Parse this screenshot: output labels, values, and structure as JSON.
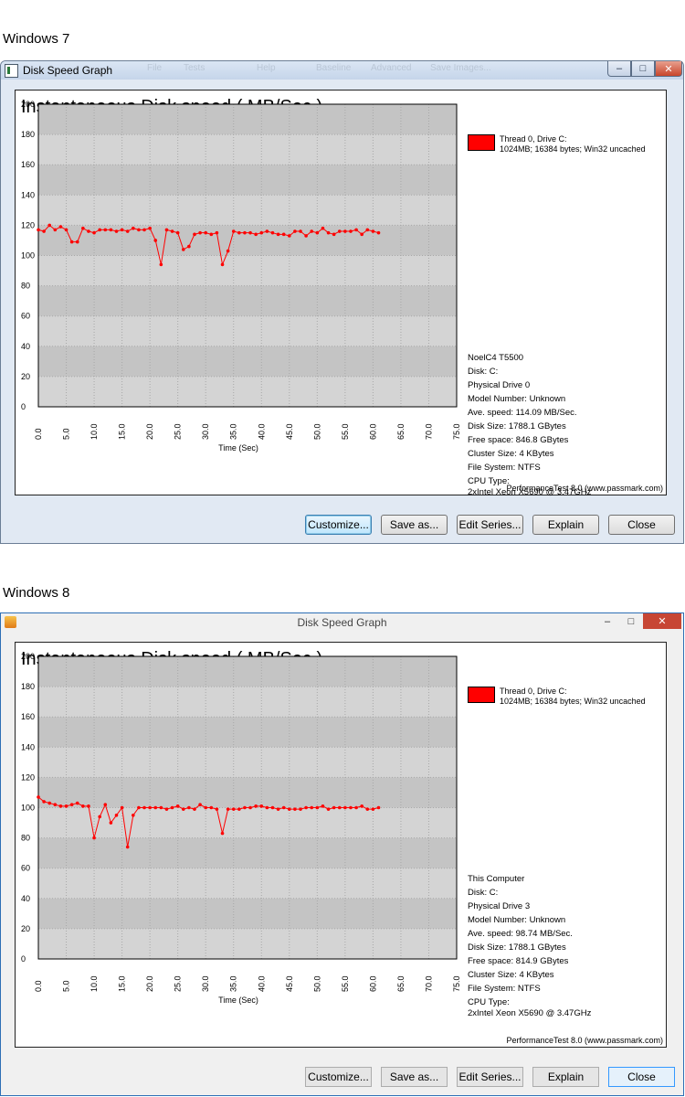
{
  "captions": {
    "win7": "Windows 7",
    "win8": "Windows 8"
  },
  "shared": {
    "window_title": "Disk Speed Graph",
    "graph_title": "Instantaneous Disk speed ( MB/Sec.)",
    "legend_line1": "Thread 0, Drive C:",
    "legend_line2": "1024MB; 16384 bytes; Win32 uncached",
    "legend_color": "#ff0000",
    "credit": "PerformanceTest 8.0 (www.passmark.com)",
    "buttons": {
      "customize": "Customize...",
      "save_as": "Save as...",
      "edit_series": "Edit Series...",
      "explain": "Explain",
      "close": "Close"
    },
    "icons": {
      "win7": "app-window-icon",
      "win8": "app-window-icon",
      "minimize": "minimize-icon",
      "maximize": "maximize-icon",
      "close": "close-icon"
    },
    "glyphs": {
      "minimize": "–",
      "maximize": "□",
      "close": "✕"
    }
  },
  "win7": {
    "background_menu": [
      "File",
      "Tests",
      "Help",
      "Baseline",
      "Advanced",
      "Save Images..."
    ],
    "info": {
      "machine": "NoelC4 T5500",
      "disk": "Disk: C:",
      "physical_drive": "Physical Drive 0",
      "model_number": "Model Number: Unknown",
      "ave_speed": "Ave. speed: 114.09 MB/Sec.",
      "disk_size": "Disk Size: 1788.1 GBytes",
      "free_space": "Free space: 846.8 GBytes",
      "cluster_size": "Cluster Size: 4 KBytes",
      "file_system": "File System: NTFS",
      "cpu_label": "CPU Type:",
      "cpu_model": "2xIntel Xeon X5690 @ 3.47GHz"
    },
    "chart_data": {
      "type": "line",
      "xlabel": "Time (Sec)",
      "xlim": [
        0,
        75
      ],
      "ylim": [
        0,
        200
      ],
      "xticks": [
        "0.0",
        "5.0",
        "10.0",
        "15.0",
        "20.0",
        "25.0",
        "30.0",
        "35.0",
        "40.0",
        "45.0",
        "50.0",
        "55.0",
        "60.0",
        "65.0",
        "70.0",
        "75.0"
      ],
      "yticks": [
        "0",
        "20",
        "40",
        "60",
        "80",
        "100",
        "120",
        "140",
        "160",
        "180",
        "200"
      ],
      "grid": true,
      "legend_position": "top-right",
      "series": [
        {
          "name": "Thread 0, Drive C:",
          "color": "#ff0000",
          "x": [
            0,
            1,
            2,
            3,
            4,
            5,
            6,
            7,
            8,
            9,
            10,
            11,
            12,
            13,
            14,
            15,
            16,
            17,
            18,
            19,
            20,
            21,
            22,
            23,
            24,
            25,
            26,
            27,
            28,
            29,
            30,
            31,
            32,
            33,
            34,
            35,
            36,
            37,
            38,
            39,
            40,
            41,
            42,
            43,
            44,
            45,
            46,
            47,
            48,
            49,
            50,
            51,
            52,
            53,
            54,
            55,
            56,
            57,
            58,
            59,
            60,
            61
          ],
          "y": [
            117,
            116,
            120,
            117,
            119,
            117,
            109,
            109,
            118,
            116,
            115,
            117,
            117,
            117,
            116,
            117,
            116,
            118,
            117,
            117,
            118,
            110,
            94,
            117,
            116,
            115,
            104,
            106,
            114,
            115,
            115,
            114,
            115,
            94,
            103,
            116,
            115,
            115,
            115,
            114,
            115,
            116,
            115,
            114,
            114,
            113,
            116,
            116,
            113,
            116,
            115,
            118,
            115,
            114,
            116,
            116,
            116,
            117,
            114,
            117,
            116,
            115
          ]
        }
      ]
    }
  },
  "win8": {
    "info": {
      "machine": "This Computer",
      "disk": "Disk: C:",
      "physical_drive": "Physical Drive 3",
      "model_number": "Model Number: Unknown",
      "ave_speed": "Ave. speed: 98.74 MB/Sec.",
      "disk_size": "Disk Size: 1788.1 GBytes",
      "free_space": "Free space: 814.9 GBytes",
      "cluster_size": "Cluster Size: 4 KBytes",
      "file_system": "File System: NTFS",
      "cpu_label": "CPU Type:",
      "cpu_model": "2xIntel Xeon X5690 @ 3.47GHz"
    },
    "chart_data": {
      "type": "line",
      "xlabel": "Time (Sec)",
      "xlim": [
        0,
        75
      ],
      "ylim": [
        0,
        200
      ],
      "xticks": [
        "0.0",
        "5.0",
        "10.0",
        "15.0",
        "20.0",
        "25.0",
        "30.0",
        "35.0",
        "40.0",
        "45.0",
        "50.0",
        "55.0",
        "60.0",
        "65.0",
        "70.0",
        "75.0"
      ],
      "yticks": [
        "0",
        "20",
        "40",
        "60",
        "80",
        "100",
        "120",
        "140",
        "160",
        "180",
        "200"
      ],
      "grid": true,
      "legend_position": "top-right",
      "series": [
        {
          "name": "Thread 0, Drive C:",
          "color": "#ff0000",
          "x": [
            0,
            1,
            2,
            3,
            4,
            5,
            6,
            7,
            8,
            9,
            10,
            11,
            12,
            13,
            14,
            15,
            16,
            17,
            18,
            19,
            20,
            21,
            22,
            23,
            24,
            25,
            26,
            27,
            28,
            29,
            30,
            31,
            32,
            33,
            34,
            35,
            36,
            37,
            38,
            39,
            40,
            41,
            42,
            43,
            44,
            45,
            46,
            47,
            48,
            49,
            50,
            51,
            52,
            53,
            54,
            55,
            56,
            57,
            58,
            59,
            60,
            61
          ],
          "y": [
            107,
            104,
            103,
            102,
            101,
            101,
            102,
            103,
            101,
            101,
            80,
            94,
            102,
            90,
            95,
            100,
            74,
            95,
            100,
            100,
            100,
            100,
            100,
            99,
            100,
            101,
            99,
            100,
            99,
            102,
            100,
            100,
            99,
            83,
            99,
            99,
            99,
            100,
            100,
            101,
            101,
            100,
            100,
            99,
            100,
            99,
            99,
            99,
            100,
            100,
            100,
            101,
            99,
            100,
            100,
            100,
            100,
            100,
            101,
            99,
            99,
            100
          ]
        }
      ]
    }
  }
}
